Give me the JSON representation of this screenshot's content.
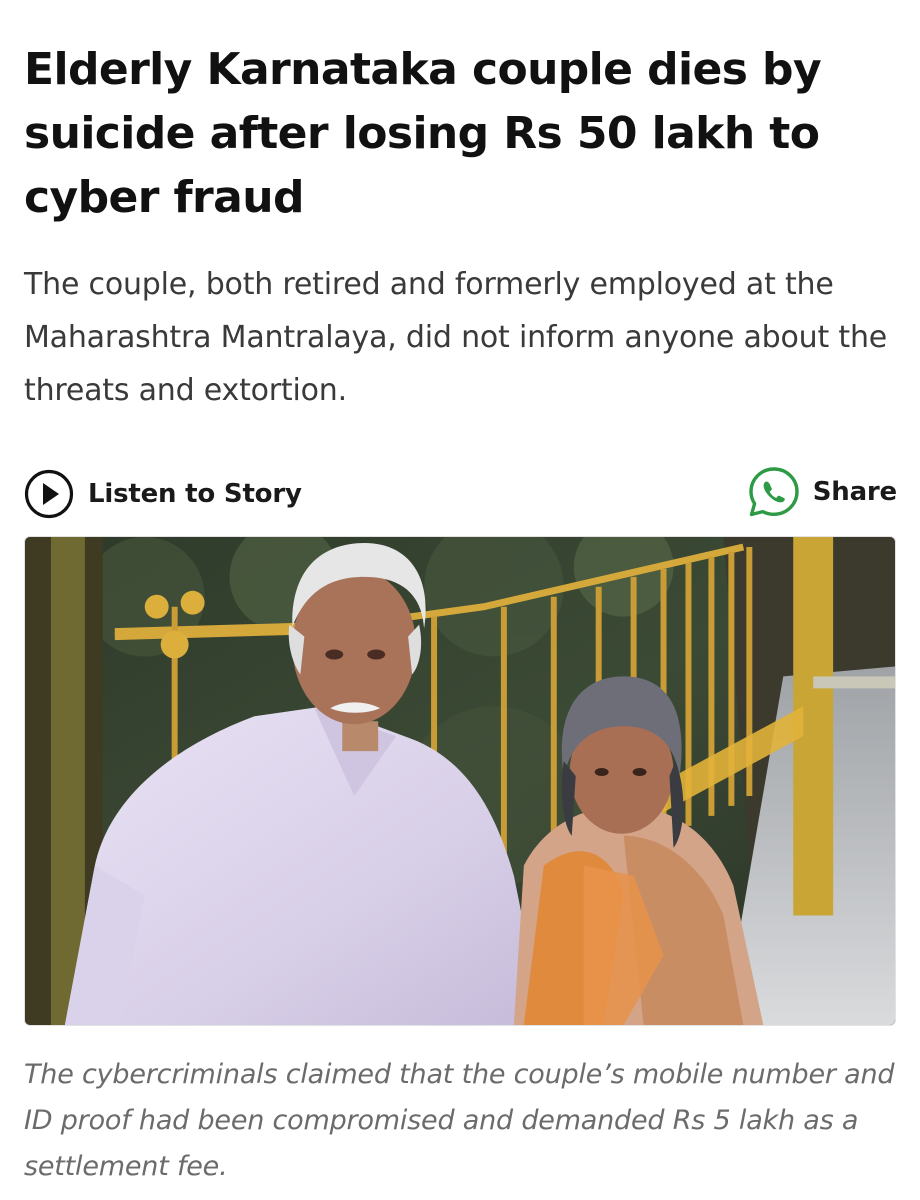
{
  "article": {
    "headline": "Elderly Karnataka couple dies by suicide after losing Rs 50 lakh to cyber fraud",
    "summary": "The couple, both retired and formerly employed at the Maharashtra Mantralaya, did not inform anyone about the threats and extortion.",
    "actions": {
      "listen_label": "Listen to Story",
      "listen_icon": "play-circle-icon",
      "share_label": "Share",
      "share_icon": "whatsapp-icon",
      "share_color": "#25a244"
    },
    "photo": {
      "subject": "elderly-couple-photo"
    },
    "caption": "The cybercriminals claimed that the couple’s mobile number and ID proof had been compromised and demanded Rs 5 lakh as a settlement fee."
  }
}
